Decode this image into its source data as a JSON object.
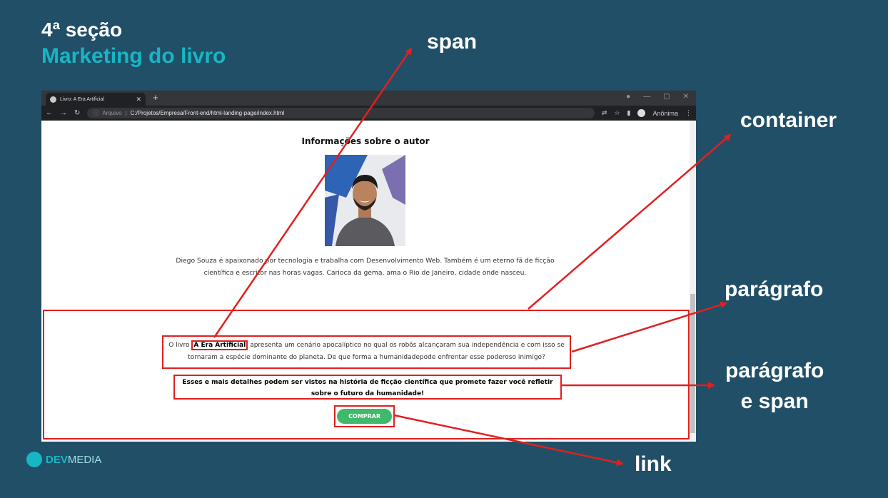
{
  "slide": {
    "title": "4ª seção",
    "subtitle": "Marketing do livro"
  },
  "annotations": {
    "span": "span",
    "container": "container",
    "paragrafo1": "parágrafo",
    "paragrafo2_line1": "parágrafo",
    "paragrafo2_line2": "e span",
    "link": "link"
  },
  "browser": {
    "tab_title": "Livro: A Era Artificial",
    "url_prefix": "Arquivo",
    "url": "C:/Projetos/Empresa/Front-end/html-landing-page/index.html",
    "profile": "Anônima"
  },
  "page": {
    "author_heading": "Informações sobre o autor",
    "author_text": "Diego Souza é apaixonado por tecnologia e trabalha com Desenvolvimento Web. Também é um eterno fã de ficção científica e escritor nas horas vagas. Carioca da gema, ama o Rio de Janeiro, cidade onde nasceu.",
    "para1_before": "O livro ",
    "para1_span": "A Era Artificial",
    "para1_after": " apresenta um cenário apocalíptico no qual os robôs alcançaram sua independência e com isso se tornaram a espécie dominante do planeta. De que forma a humanidadepode enfrentar esse poderoso inimigo?",
    "para2": "Esses e mais detalhes podem ser vistos na história de ficção científica que promete fazer você refletir sobre o futuro da humanidade!",
    "buy_button": "COMPRAR"
  },
  "logo": {
    "brand_a": "DEV",
    "brand_b": "MEDIA"
  },
  "colors": {
    "background": "#214f67",
    "accent": "#17b6c4",
    "annotation": "#e02020",
    "button": "#3fb96c"
  }
}
